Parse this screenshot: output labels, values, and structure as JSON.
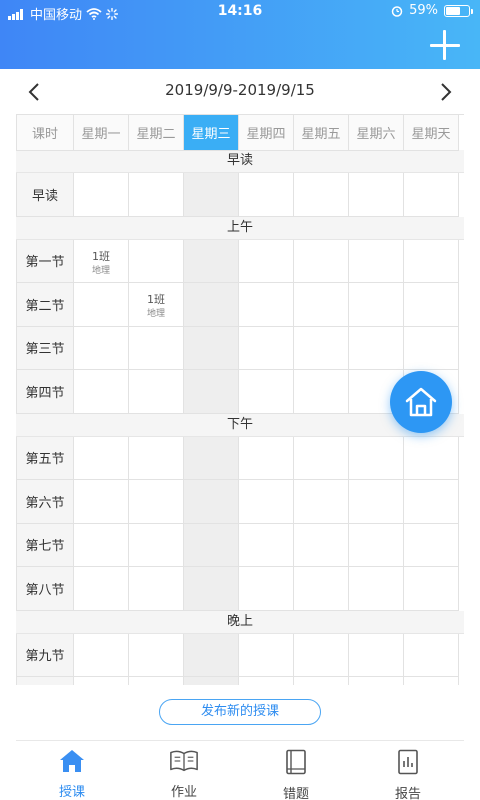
{
  "status_bar": {
    "carrier": "中国移动",
    "time": "14:16",
    "battery": "59%"
  },
  "week": {
    "range": "2019/9/9-2019/9/15"
  },
  "timetable": {
    "corner_label": "课时",
    "days": [
      "星期一",
      "星期二",
      "星期三",
      "星期四",
      "星期五",
      "星期六",
      "星期天"
    ],
    "active_day_index": 2,
    "sections": [
      {
        "title": "早读",
        "periods": [
          "早读"
        ]
      },
      {
        "title": "上午",
        "periods": [
          "第一节",
          "第二节",
          "第三节",
          "第四节"
        ]
      },
      {
        "title": "下午",
        "periods": [
          "第五节",
          "第六节",
          "第七节",
          "第八节"
        ]
      },
      {
        "title": "晚上",
        "periods": [
          "第九节",
          ""
        ]
      }
    ],
    "lessons": [
      {
        "section": 1,
        "period": 0,
        "day": 0,
        "class": "1班",
        "subject": "地理"
      },
      {
        "section": 1,
        "period": 1,
        "day": 1,
        "class": "1班",
        "subject": "地理"
      }
    ]
  },
  "publish_button": "发布新的授课",
  "tabs": [
    {
      "label": "授课",
      "icon": "home-icon",
      "active": true
    },
    {
      "label": "作业",
      "icon": "book-icon",
      "active": false
    },
    {
      "label": "错题",
      "icon": "notebook-icon",
      "active": false
    },
    {
      "label": "报告",
      "icon": "report-icon",
      "active": false
    }
  ],
  "colors": {
    "accent": "#3aaef5",
    "header_start": "#3f86f6",
    "header_end": "#48b6f7",
    "fab": "#2d97f4"
  }
}
